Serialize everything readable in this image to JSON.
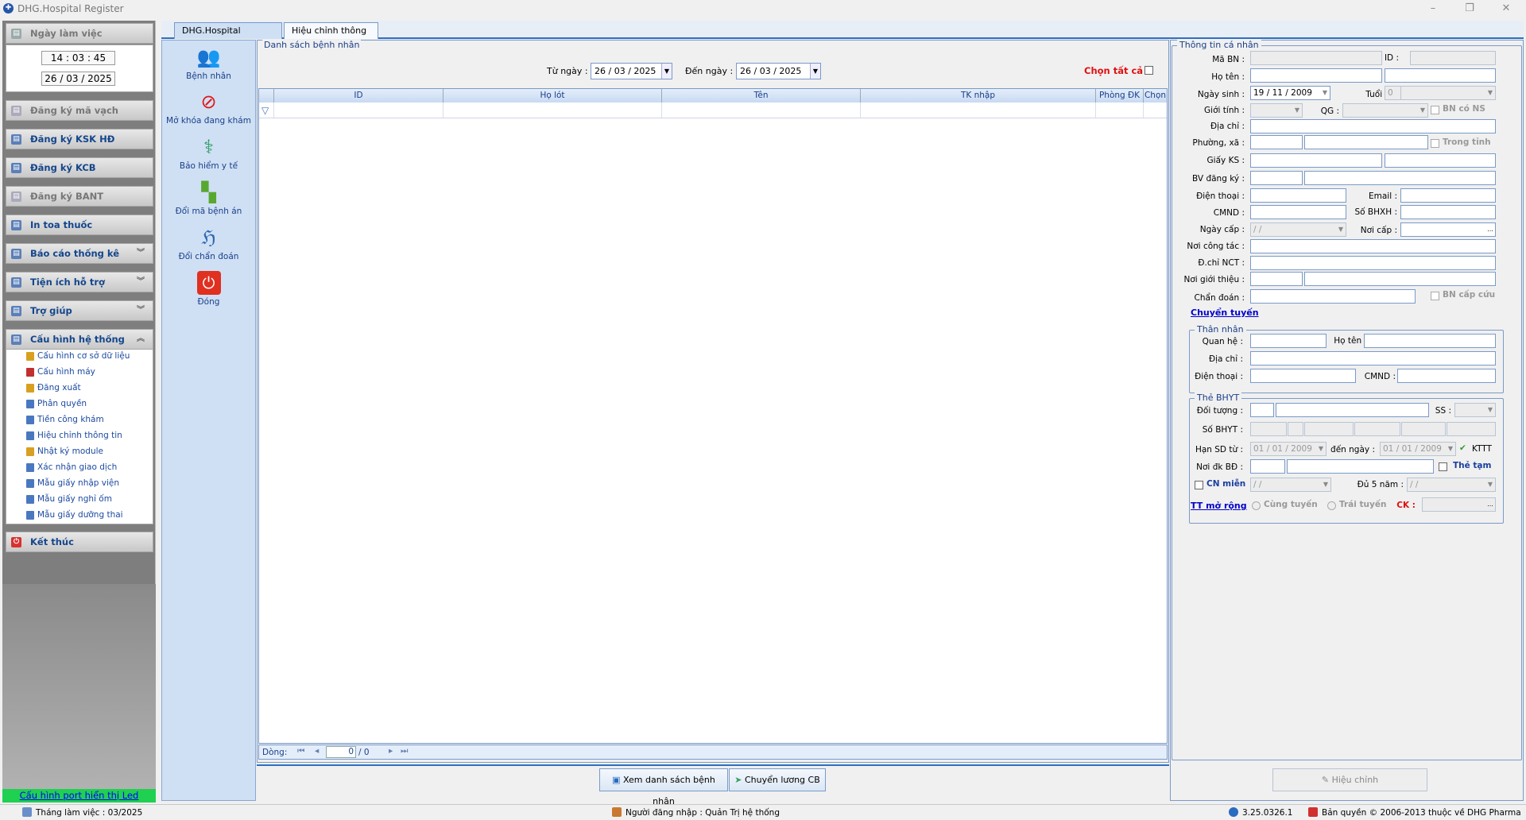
{
  "window": {
    "title": "DHG.Hospital Register",
    "minimize": "–",
    "restore": "❐",
    "close": "✕"
  },
  "left": {
    "workday_label": "Ngày làm việc",
    "time": "14 : 03 : 45",
    "date": "26 / 03 / 2025",
    "groups": [
      {
        "label": "Đăng ký mã vạch",
        "state": "disabled"
      },
      {
        "label": "Đăng ký KSK HĐ",
        "state": "enabled"
      },
      {
        "label": "Đăng ký KCB",
        "state": "enabled"
      },
      {
        "label": "Đăng ký BANT",
        "state": "disabled"
      },
      {
        "label": "In toa thuốc",
        "state": "enabled"
      },
      {
        "label": "Báo cáo thống kê",
        "state": "collapsed"
      },
      {
        "label": "Tiện ích hỗ trợ",
        "state": "collapsed"
      },
      {
        "label": "Trợ giúp",
        "state": "collapsed"
      },
      {
        "label": "Cấu hình hệ thống",
        "state": "expanded"
      }
    ],
    "config_items": [
      "Cấu hình cơ sở dữ liệu",
      "Cấu hình máy",
      "Đăng xuất",
      "Phân quyền",
      "Tiền công khám",
      "Hiệu chỉnh thông tin",
      "Nhật ký module",
      "Xác nhận giao dịch",
      "Mẫu giấy nhập viện",
      "Mẫu giấy nghỉ ốm",
      "Mẫu giấy dưỡng thai"
    ],
    "exit_label": "Kết thúc",
    "led_link": "Cấu hình port hiển thị Led"
  },
  "tabs": [
    {
      "label": "DHG.Hospital Register"
    },
    {
      "label": "Hiệu chỉnh thông tin",
      "active": true
    }
  ],
  "toolbar": [
    {
      "label": "Bệnh nhân",
      "icon": "patients-icon"
    },
    {
      "label": "Mở khóa đang khám",
      "icon": "no-entry-icon"
    },
    {
      "label": "Bảo hiểm y tế",
      "icon": "caduceus-icon"
    },
    {
      "label": "Đổi mã bệnh án",
      "icon": "squares-icon"
    },
    {
      "label": "Đổi chẩn đoán",
      "icon": "stethoscope-icon"
    },
    {
      "label": "Đóng",
      "icon": "close-power-icon"
    }
  ],
  "list": {
    "legend": "Danh sách bệnh nhân",
    "from_label": "Từ ngày :",
    "from": "26 / 03 / 2025",
    "to_label": "Đến  ngày :",
    "to": "26 / 03 / 2025",
    "select_all": "Chọn tất cả",
    "columns": [
      "ID",
      "Họ lót",
      "Tên",
      "TK nhập",
      "Phòng ĐK",
      "Chọn"
    ],
    "nav_label": "Dòng:",
    "nav_page": "0",
    "nav_total": "/   0"
  },
  "buttons": {
    "view_list": "Xem danh sách bệnh nhân",
    "transfer": "Chuyển lương CB",
    "edit": "Hiệu chỉnh"
  },
  "info": {
    "legend": "Thông tin cá nhân",
    "ma_bn": "Mã BN :",
    "id": "ID :",
    "ho_ten": "Họ tên :",
    "ngay_sinh": "Ngày sinh :",
    "dob": "19 / 11 / 2009",
    "tuoi": "Tuổi :",
    "tuoi_val": "0",
    "bn_co_ns": "BN có NS",
    "gioi_tinh": "Giới tính :",
    "qg": "QG :",
    "dia_chi": "Địa chỉ :",
    "phuong_xa": "Phường, xã :",
    "trong_tinh": "Trong tỉnh",
    "giay_ks": "Giấy KS :",
    "bv_dang_ky": "BV đăng ký :",
    "dien_thoai": "Điện thoại :",
    "email": "Email :",
    "cmnd": "CMND :",
    "so_bhxh": "Số BHXH :",
    "ngay_cap": "Ngày cấp :",
    "ngay_cap_val": "/    /",
    "noi_cap": "Nơi cấp :",
    "ellipsis": "...",
    "noi_cong_tac": "Nơi công tác :",
    "dchi_nct": "Đ.chỉ NCT :",
    "noi_gioi_thieu": "Nơi giới thiệu :",
    "chan_doan": "Chẩn đoán :",
    "bn_cap_cuu": "BN cấp cứu",
    "chuyen_tuyen": "Chuyển tuyến"
  },
  "relative": {
    "legend": "Thân nhân",
    "quan_he": "Quan hệ :",
    "ho_ten": "Họ tên :",
    "dia_chi": "Địa chỉ :",
    "dien_thoai": "Điện thoại :",
    "cmnd": "CMND :"
  },
  "bhyt": {
    "legend": "Thẻ BHYT",
    "doi_tuong": "Đối tượng :",
    "ss": "SS :",
    "so_bhyt": "Số BHYT :",
    "han_sd": "Hạn SD từ :",
    "han_from": "01 / 01 / 2009",
    "den_ngay": "đến  ngày :",
    "han_to": "01 / 01 / 2009",
    "kttt": "KTTT",
    "noi_dk_bd": "Nơi đk BĐ :",
    "the_tam": "Thẻ tạm",
    "cn_mien": "CN miễn",
    "cn_mien_date": "/    /",
    "du5nam": "Đủ 5 năm :",
    "du5nam_date": "/    /",
    "tt_mo_rong": "TT mở rộng",
    "cung_tuyen": "Cùng tuyến",
    "trai_tuyen": "Trái tuyến",
    "ck": "CK :",
    "ellipsis": "..."
  },
  "status": {
    "month": "Tháng làm việc : 03/2025",
    "user": "Người đăng nhập : Quản Trị hệ thống",
    "version": "3.25.0326.1",
    "copyright": "Bản quyền © 2006-2013 thuộc về DHG Pharma"
  }
}
